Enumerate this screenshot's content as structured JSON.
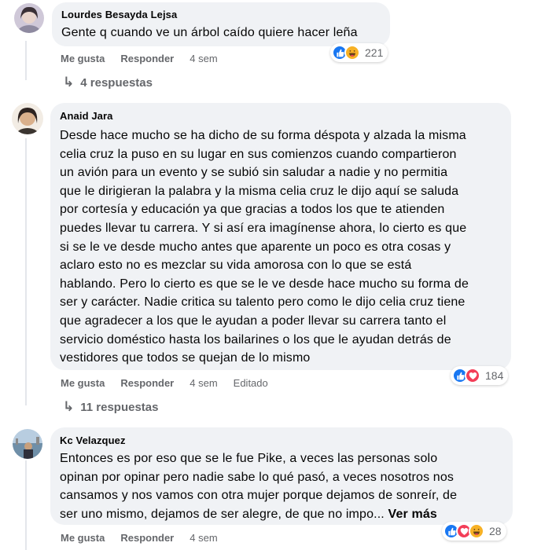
{
  "comments": [
    {
      "author": "Lourdes Besayda Lejsa",
      "text": "Gente q cuando ve un árbol caído quiere hacer leña",
      "reaction_count": "221",
      "reactions": [
        "like-icon",
        "haha-icon"
      ],
      "like_label": "Me gusta",
      "reply_label": "Responder",
      "time": "4 sem",
      "replies_label": "4 respuestas"
    },
    {
      "author": "Anaid Jara",
      "text_lines": [
        "Desde hace mucho se ha dicho de su forma déspota y alzada la misma",
        "celia cruz la puso en su lugar en sus comienzos cuando compartieron",
        "un avión para un evento y se subió sin saludar a nadie y no permitia",
        "que le dirigieran la palabra y la misma celia cruz le dijo aquí se saluda",
        "por cortesía y educación ya que gracias a todos los que te atienden",
        "puedes llevar tu carrera. Y si así era imagínense ahora, lo cierto es que",
        "si se le ve desde mucho antes que aparente un poco es otra cosas y",
        "aclaro esto no es mezclar su vida amorosa con lo que se está",
        "hablando. Pero lo cierto es que se le ve desde hace mucho su forma de",
        "ser y carácter. Nadie critica su talento pero como le dijo celia cruz tiene",
        "que agradecer a los que le ayudan a poder llevar su carrera tanto el",
        "servicio doméstico hasta los bailarines o los que le ayudan detrás de",
        "vestidores que todos se quejan de lo mismo"
      ],
      "reaction_count": "184",
      "reactions": [
        "like-icon",
        "love-icon"
      ],
      "like_label": "Me gusta",
      "reply_label": "Responder",
      "time": "4 sem",
      "edited_label": "Editado",
      "replies_label": "11 respuestas"
    },
    {
      "author": "Kc Velazquez",
      "text_lines": [
        "Entonces es por eso que se le fue Pike, a veces las personas solo",
        "opinan por opinar pero nadie sabe lo qué pasó, a veces nosotros nos",
        "cansamos y nos vamos con otra mujer porque dejamos de sonreír, de",
        "ser uno mismo, dejamos de ser alegre, de que no impo... "
      ],
      "see_more": "Ver más",
      "reaction_count": "28",
      "reactions": [
        "like-icon",
        "love-icon",
        "haha-icon"
      ],
      "like_label": "Me gusta",
      "reply_label": "Responder",
      "time": "4 sem"
    }
  ],
  "colors": {
    "bubble": "#f0f2f5",
    "meta_text": "#65676b",
    "like_blue": "#1877f2",
    "love_red": "#f33e58",
    "haha_yellow": "#f7b125"
  }
}
